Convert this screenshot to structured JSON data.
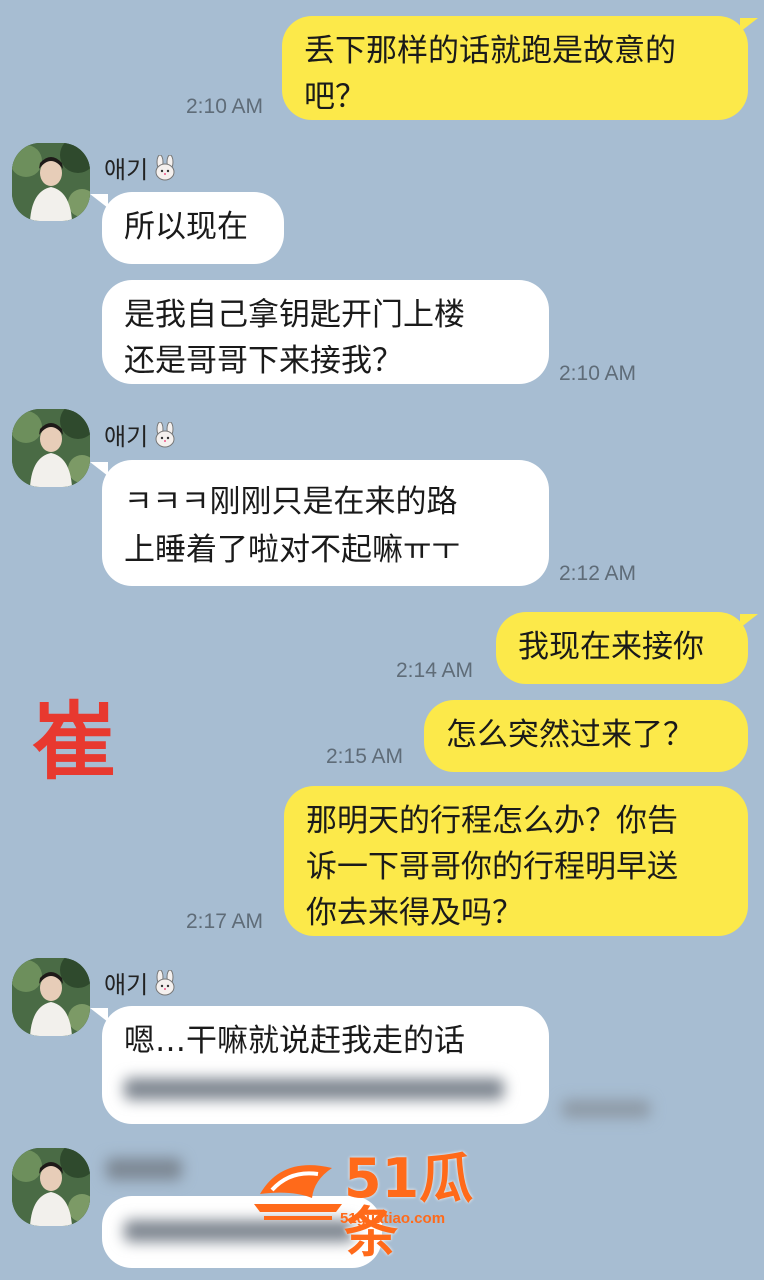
{
  "contact": {
    "name": "애기"
  },
  "messages": [
    {
      "id": "m1",
      "dir": "out",
      "lines": [
        "丢下那样的话就跑是故意的",
        "吧？"
      ],
      "time": "2:10 AM"
    },
    {
      "id": "m2",
      "dir": "in",
      "lines": [
        "所以现在"
      ]
    },
    {
      "id": "m3",
      "dir": "in",
      "lines": [
        "是我自己拿钥匙开门上楼",
        "还是哥哥下来接我？"
      ],
      "time": "2:10 AM"
    },
    {
      "id": "m4",
      "dir": "in",
      "lines": [
        "ㅋㅋㅋ刚刚只是在来的路",
        "上睡着了啦对不起嘛ㅠㅜ"
      ],
      "time": "2:12 AM"
    },
    {
      "id": "m5",
      "dir": "out",
      "lines": [
        "我现在来接你"
      ],
      "time": "2:14 AM"
    },
    {
      "id": "m6",
      "dir": "out",
      "lines": [
        "怎么突然过来了？"
      ],
      "time": "2:15 AM"
    },
    {
      "id": "m7",
      "dir": "out",
      "lines": [
        "那明天的行程怎么办？你告",
        "诉一下哥哥你的行程明早送",
        "你去来得及吗？"
      ],
      "time": "2:17 AM"
    },
    {
      "id": "m8",
      "dir": "in",
      "lines": [
        "嗯…干嘛就说赶我走的话"
      ]
    }
  ],
  "overlay_label": "崔",
  "watermark": {
    "brand": "51瓜条",
    "url": "51guatiao.com"
  },
  "colors": {
    "background": "#a7bdd2",
    "outgoing": "#fce94a",
    "incoming": "#ffffff",
    "overlay": "#e8392f",
    "watermark": "#ff6a1a"
  }
}
